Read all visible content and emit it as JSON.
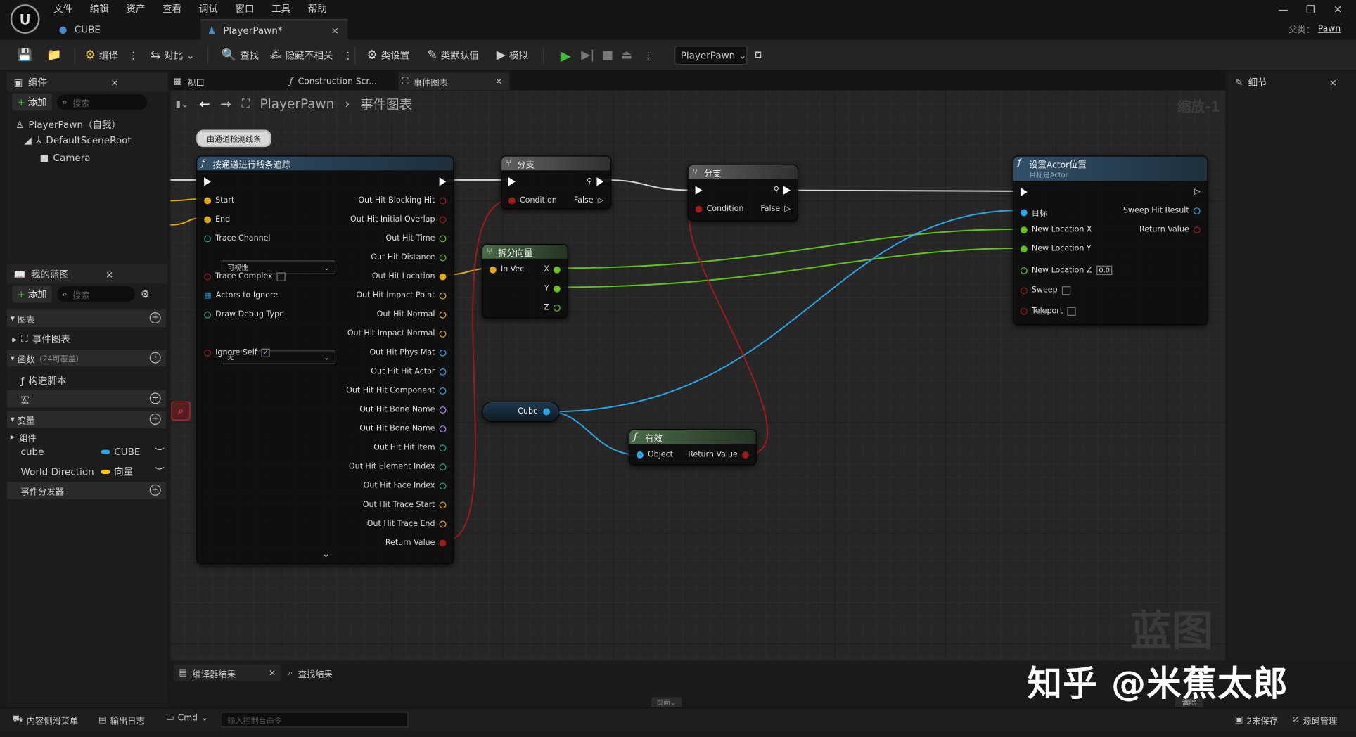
{
  "menu": {
    "items": [
      "文件",
      "编辑",
      "资产",
      "查看",
      "调试",
      "窗口",
      "工具",
      "帮助"
    ]
  },
  "doc_tabs": [
    {
      "label": "CUBE"
    },
    {
      "label": "PlayerPawn*"
    }
  ],
  "parent_class": {
    "label": "父类：",
    "value": "Pawn"
  },
  "toolbar": {
    "compile": "编译",
    "diff": "对比",
    "find": "查找",
    "hide": "隐藏不相关",
    "class_settings": "类设置",
    "class_defaults": "类默认值",
    "simulate": "模拟",
    "debug_object": "PlayerPawn"
  },
  "components": {
    "title": "组件",
    "add": "添加",
    "search_placeholder": "搜索",
    "tree": [
      "PlayerPawn（自我）",
      "DefaultSceneRoot",
      "Camera"
    ]
  },
  "my_blueprint": {
    "title": "我的蓝图",
    "add": "添加",
    "search_placeholder": "搜索",
    "graphs": "图表",
    "event_graph": "事件图表",
    "functions": "函数",
    "functions_count": "（24可覆盖）",
    "construction_script": "构造脚本",
    "macros": "宏",
    "variables": "变量",
    "components": "组件",
    "vars": [
      {
        "name": "cube",
        "type": "CUBE",
        "color": "#2aa6e8"
      },
      {
        "name": "World Direction",
        "type": "向量",
        "color": "#f5c518"
      }
    ],
    "event_dispatchers": "事件分发器"
  },
  "editor_tabs": [
    {
      "label": "视口"
    },
    {
      "label": "Construction Scr..."
    },
    {
      "label": "事件图表"
    }
  ],
  "breadcrumb": {
    "root": "PlayerPawn",
    "current": "事件图表"
  },
  "zoom": "缩放-1",
  "watermark": "蓝图",
  "comment": "由通道检测线条",
  "nodes": {
    "trace": {
      "title": "按通道进行线条追踪",
      "inputs": [
        "Start",
        "End",
        "Trace Channel",
        "Trace Complex",
        "Actors to Ignore",
        "Draw Debug Type",
        "Ignore Self"
      ],
      "trace_channel": "可视性",
      "draw_debug": "无",
      "outputs": [
        "Out Hit Blocking Hit",
        "Out Hit Initial Overlap",
        "Out Hit Time",
        "Out Hit Distance",
        "Out Hit Location",
        "Out Hit Impact Point",
        "Out Hit Normal",
        "Out Hit Impact Normal",
        "Out Hit Phys Mat",
        "Out Hit Hit Actor",
        "Out Hit Hit Component",
        "Out Hit Bone Name",
        "Out Hit Bone Name",
        "Out Hit Hit Item",
        "Out Hit Element Index",
        "Out Hit Face Index",
        "Out Hit Trace Start",
        "Out Hit Trace End",
        "Return Value"
      ]
    },
    "branch1": {
      "title": "分支",
      "condition": "Condition",
      "false_label": "False"
    },
    "branch2": {
      "title": "分支",
      "condition": "Condition",
      "false_label": "False"
    },
    "break_vec": {
      "title": "拆分向量",
      "input": "In Vec",
      "x": "X",
      "y": "Y",
      "z": "Z"
    },
    "cube": {
      "label": "Cube"
    },
    "is_valid": {
      "title": "有效",
      "object": "Object",
      "return": "Return Value"
    },
    "set_loc": {
      "title": "设置Actor位置",
      "subtitle": "目标是Actor",
      "target": "目标",
      "loc_x": "New Location X",
      "loc_y": "New Location Y",
      "loc_z": "New Location Z",
      "z_value": "0.0",
      "sweep": "Sweep",
      "teleport": "Teleport",
      "sweep_hit": "Sweep Hit Result",
      "return": "Return Value"
    }
  },
  "details": {
    "title": "细节"
  },
  "bottom_tabs": [
    {
      "label": "编译器结果"
    },
    {
      "label": "查找结果"
    }
  ],
  "bottom_misc": {
    "page": "页面",
    "clear": "清除"
  },
  "status": {
    "content_drawer": "内容侧滑菜单",
    "output_log": "输出日志",
    "cmd": "Cmd",
    "console_placeholder": "输入控制台命令",
    "unsaved": "2未保存",
    "source_control": "源码管理"
  },
  "zhihu_watermark": "知乎 @米蕉太郎"
}
